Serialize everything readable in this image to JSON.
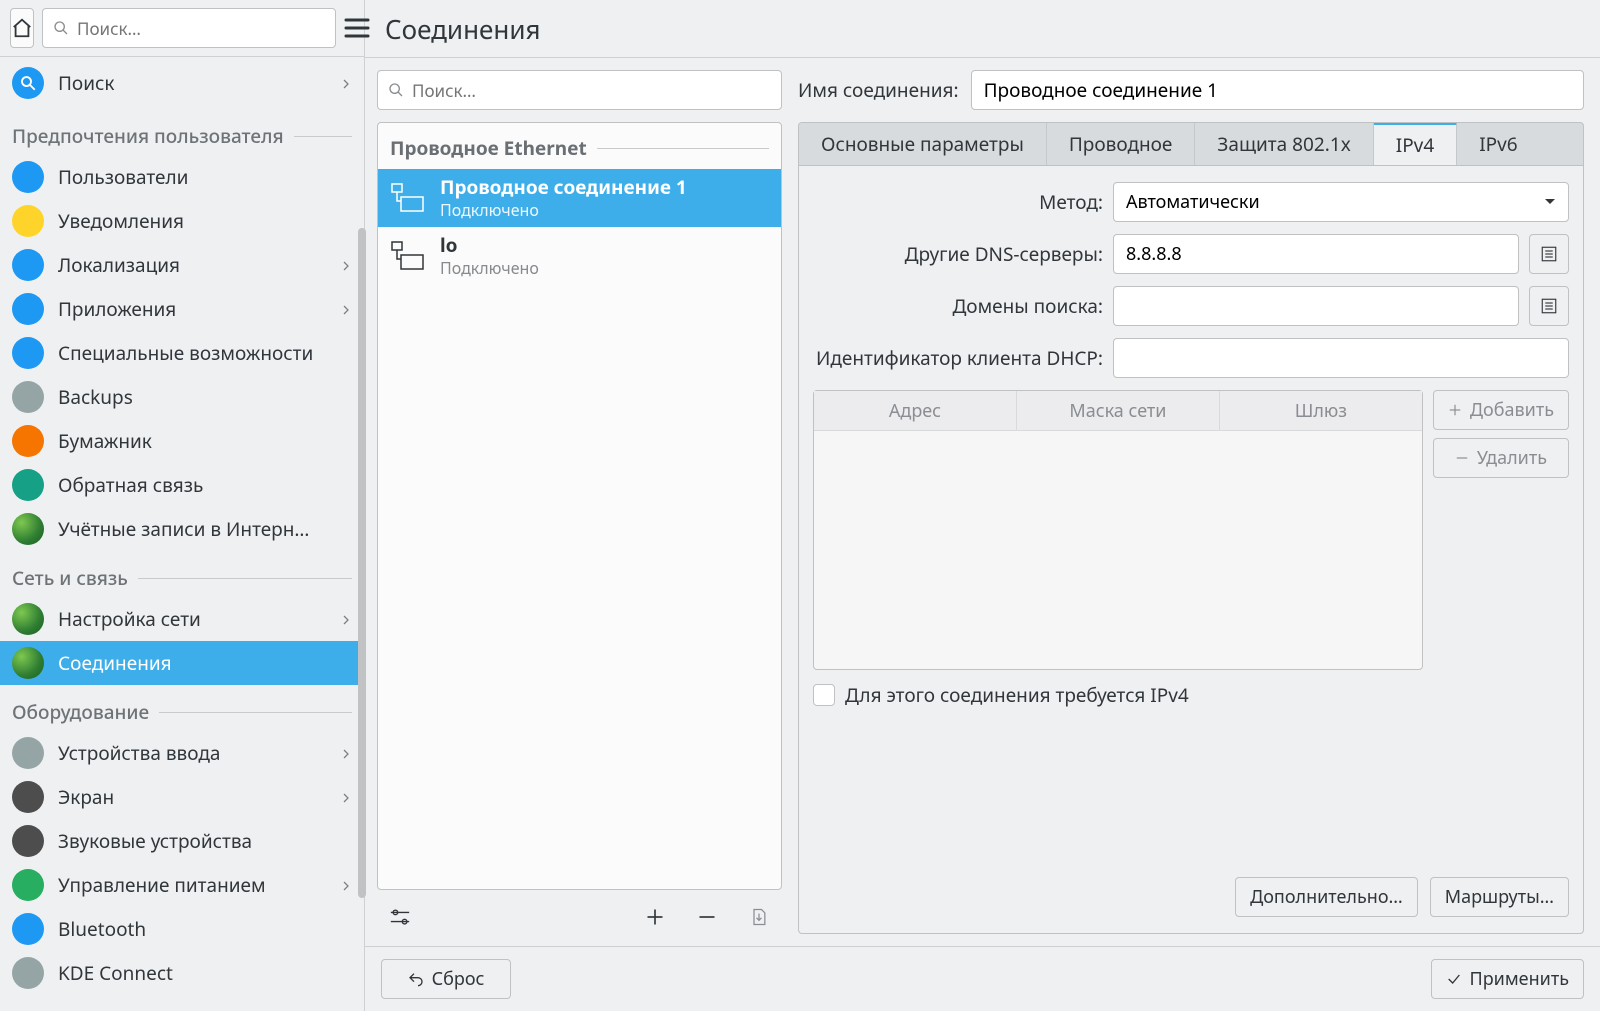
{
  "sidebar": {
    "search_placeholder": "Поиск…",
    "search_item": {
      "label": "Поиск"
    },
    "categories": [
      {
        "title": "Предпочтения пользователя",
        "items": [
          {
            "label": "Пользователи",
            "icon": "users-icon",
            "color": "ic-blue",
            "chevron": false
          },
          {
            "label": "Уведомления",
            "icon": "bell-icon",
            "color": "ic-yellow",
            "chevron": false
          },
          {
            "label": "Локализация",
            "icon": "locale-icon",
            "color": "ic-blue",
            "chevron": true
          },
          {
            "label": "Приложения",
            "icon": "apps-icon",
            "color": "ic-blue",
            "chevron": true
          },
          {
            "label": "Специальные возможности",
            "icon": "accessibility-icon",
            "color": "ic-blue",
            "chevron": false
          },
          {
            "label": "Backups",
            "icon": "backup-icon",
            "color": "ic-gray",
            "chevron": false
          },
          {
            "label": "Бумажник",
            "icon": "wallet-icon",
            "color": "ic-orange",
            "chevron": false
          },
          {
            "label": "Обратная связь",
            "icon": "feedback-icon",
            "color": "ic-teal",
            "chevron": false
          },
          {
            "label": "Учётные записи в Интерн…",
            "icon": "accounts-icon",
            "color": "ic-globe",
            "chevron": false
          }
        ]
      },
      {
        "title": "Сеть и связь",
        "items": [
          {
            "label": "Настройка сети",
            "icon": "network-icon",
            "color": "ic-globe",
            "chevron": true
          },
          {
            "label": "Соединения",
            "icon": "connections-icon",
            "color": "ic-globe",
            "chevron": false,
            "selected": true
          }
        ]
      },
      {
        "title": "Оборудование",
        "items": [
          {
            "label": "Устройства ввода",
            "icon": "mouse-icon",
            "color": "ic-gray",
            "chevron": true
          },
          {
            "label": "Экран",
            "icon": "display-icon",
            "color": "ic-dark",
            "chevron": true
          },
          {
            "label": "Звуковые устройства",
            "icon": "sound-icon",
            "color": "ic-dark",
            "chevron": false
          },
          {
            "label": "Управление питанием",
            "icon": "power-icon",
            "color": "ic-green",
            "chevron": true
          },
          {
            "label": "Bluetooth",
            "icon": "bluetooth-icon",
            "color": "ic-blue",
            "chevron": false
          },
          {
            "label": "KDE Connect",
            "icon": "kdeconnect-icon",
            "color": "ic-gray",
            "chevron": false
          }
        ]
      }
    ]
  },
  "main": {
    "title": "Соединения",
    "conn_search_placeholder": "Поиск…",
    "reset_label": "Сброс",
    "apply_label": "Применить",
    "conn_group_title": "Проводное Ethernet",
    "connections": [
      {
        "name": "Проводное соединение 1",
        "status": "Подключено",
        "selected": true
      },
      {
        "name": "lo",
        "status": "Подключено",
        "selected": false
      }
    ],
    "name_label": "Имя соединения:",
    "name_value": "Проводное соединение 1",
    "tabs": [
      {
        "label": "Основные параметры",
        "active": false
      },
      {
        "label": "Проводное",
        "active": false
      },
      {
        "label": "Защита 802.1x",
        "active": false
      },
      {
        "label": "IPv4",
        "active": true
      },
      {
        "label": "IPv6",
        "active": false
      }
    ],
    "ipv4": {
      "method_label": "Метод:",
      "method_value": "Автоматически",
      "dns_label": "Другие DNS-серверы:",
      "dns_value": "8.8.8.8",
      "domains_label": "Домены поиска:",
      "domains_value": "",
      "dhcp_label": "Идентификатор клиента DHCP:",
      "dhcp_value": "",
      "table_headers": {
        "addr": "Адрес",
        "mask": "Маска сети",
        "gw": "Шлюз"
      },
      "add_label": "Добавить",
      "remove_label": "Удалить",
      "require_label": "Для этого соединения требуется IPv4",
      "advanced_label": "Дополнительно…",
      "routes_label": "Маршруты…"
    }
  }
}
